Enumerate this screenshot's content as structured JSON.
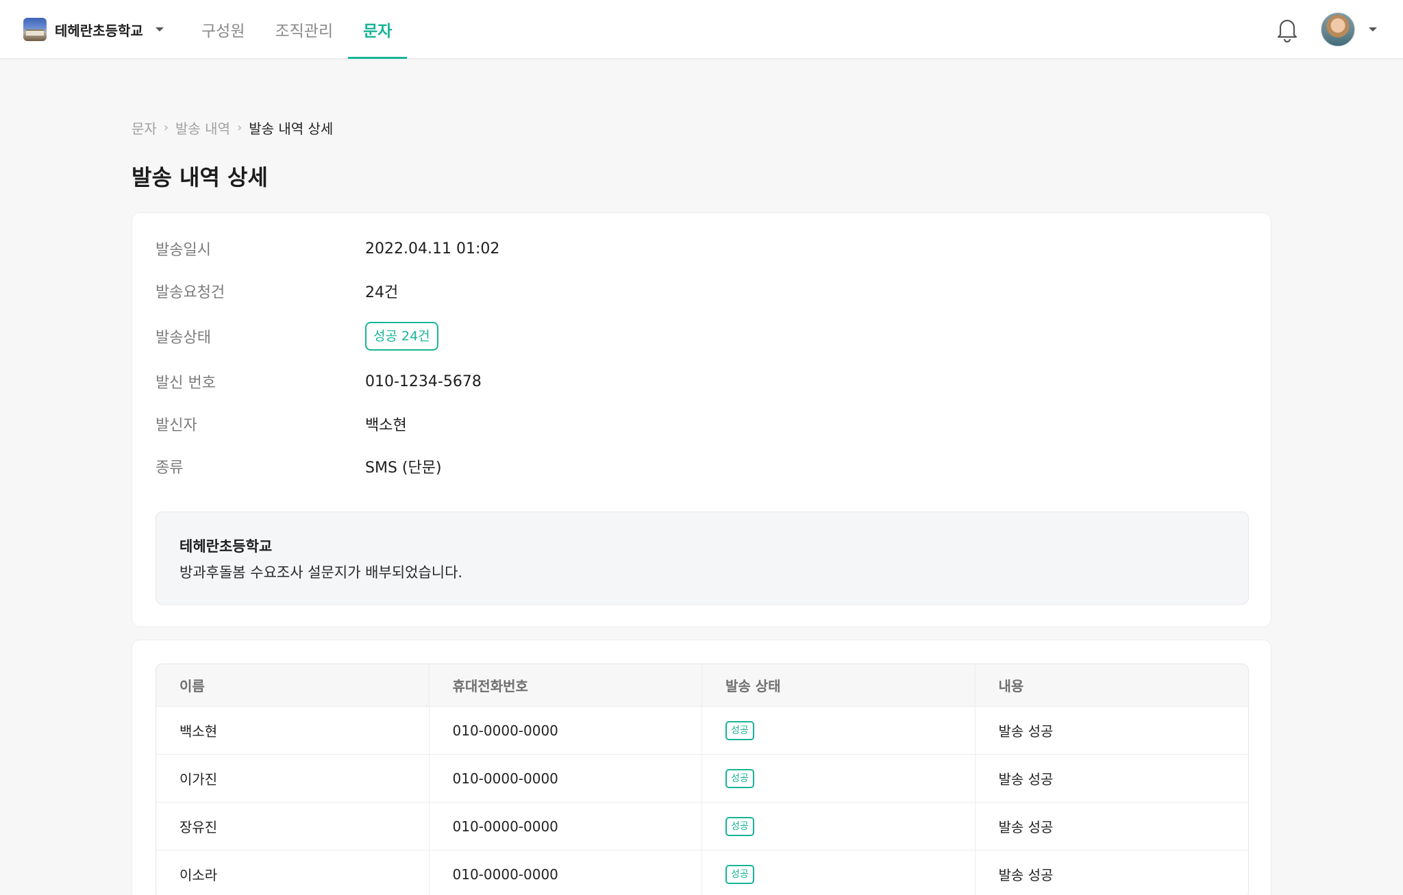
{
  "header": {
    "school_name": "테헤란초등학교",
    "nav": [
      {
        "label": "구성원",
        "active": false
      },
      {
        "label": "조직관리",
        "active": false
      },
      {
        "label": "문자",
        "active": true
      }
    ],
    "icons": {
      "notification": "bell-icon",
      "account_menu": "chevron-down-icon"
    },
    "accent_color": "#16b596"
  },
  "breadcrumb": [
    "문자",
    "발송 내역",
    "발송 내역 상세"
  ],
  "page_title": "발송 내역 상세",
  "details": {
    "sent_at_label": "발송일시",
    "sent_at": "2022.04.11 01:02",
    "request_count_label": "발송요청건",
    "request_count": "24건",
    "status_label": "발송상태",
    "status": "성공 24건",
    "sender_number_label": "발신 번호",
    "sender_number": "010-1234-5678",
    "sender_label": "발신자",
    "sender": "백소현",
    "type_label": "종류",
    "type": "SMS (단문)"
  },
  "message": {
    "title": "테헤란초등학교",
    "body": "방과후돌봄 수요조사 설문지가 배부되었습니다."
  },
  "table": {
    "columns": [
      "이름",
      "휴대전화번호",
      "발송 상태",
      "내용"
    ],
    "rows": [
      {
        "name": "백소현",
        "phone": "010-0000-0000",
        "status": "성공",
        "content": "발송 성공"
      },
      {
        "name": "이가진",
        "phone": "010-0000-0000",
        "status": "성공",
        "content": "발송 성공"
      },
      {
        "name": "장유진",
        "phone": "010-0000-0000",
        "status": "성공",
        "content": "발송 성공"
      },
      {
        "name": "이소라",
        "phone": "010-0000-0000",
        "status": "성공",
        "content": "발송 성공"
      }
    ]
  }
}
